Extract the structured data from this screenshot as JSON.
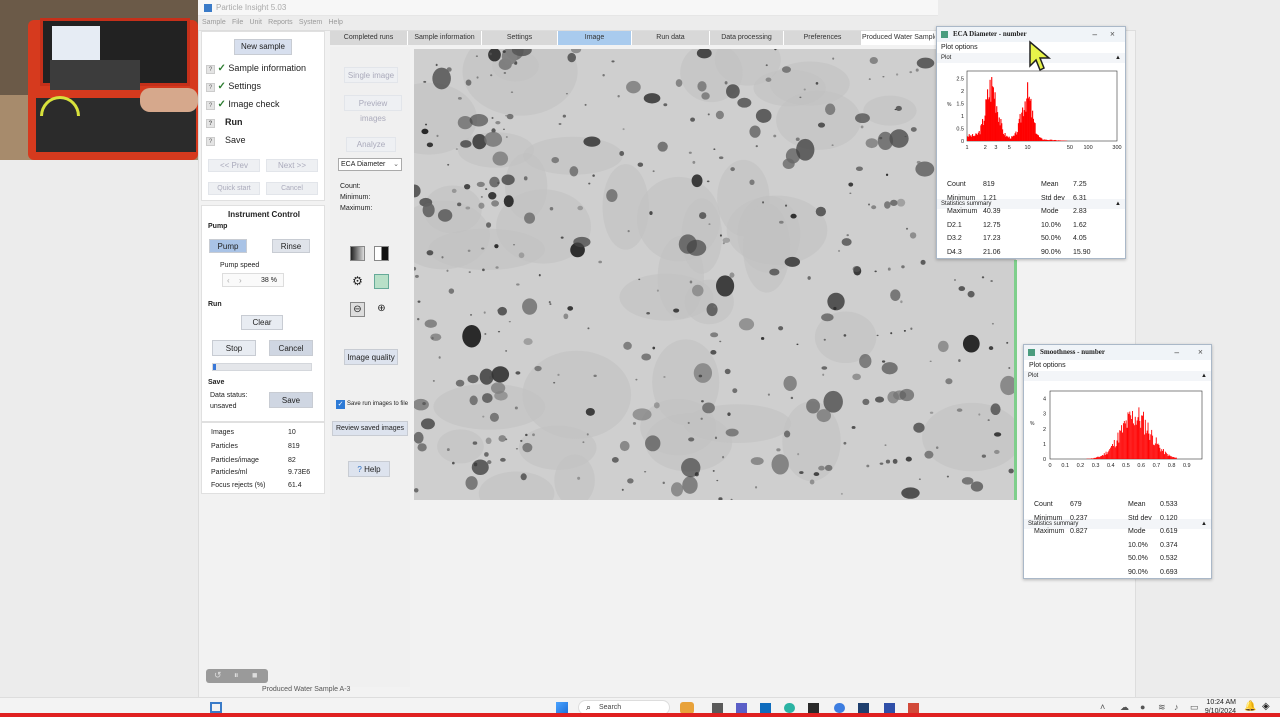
{
  "app": {
    "title": "Particle Insight   5.03",
    "menu": [
      "Sample",
      "File",
      "Unit",
      "Reports",
      "System",
      "Help"
    ]
  },
  "workflow": {
    "new_sample": "New sample",
    "steps": [
      {
        "label": "Sample information",
        "state": "done"
      },
      {
        "label": "Settings",
        "state": "done"
      },
      {
        "label": "Image check",
        "state": "done"
      },
      {
        "label": "Run",
        "state": "current"
      },
      {
        "label": "Save",
        "state": "pending"
      }
    ],
    "prev": "<< Prev",
    "next": "Next >>",
    "quick_start": "Quick start",
    "cancel": "Cancel"
  },
  "instrument": {
    "title": "Instrument Control",
    "pump_header": "Pump",
    "pump_btn": "Pump",
    "rinse_btn": "Rinse",
    "pump_speed_label": "Pump speed",
    "pump_speed_value": "38 %",
    "run_header": "Run",
    "clear_btn": "Clear",
    "stop_btn": "Stop",
    "cancel_btn": "Cancel",
    "progress": 0.03,
    "save_header": "Save",
    "data_status_label": "Data status:",
    "data_status_value": "unsaved",
    "save_btn": "Save"
  },
  "summary": {
    "rows": [
      {
        "label": "Images",
        "value": "10"
      },
      {
        "label": "Particles",
        "value": "819"
      },
      {
        "label": "Particles/image",
        "value": "82"
      },
      {
        "label": "Particles/ml",
        "value": "9.73E6"
      },
      {
        "label": "Focus rejects (%)",
        "value": "61.4"
      }
    ]
  },
  "tabs": [
    {
      "label": "Completed runs",
      "active": false
    },
    {
      "label": "Sample information",
      "active": false
    },
    {
      "label": "Settings",
      "active": false
    },
    {
      "label": "Image",
      "active": true
    },
    {
      "label": "Run data",
      "active": false
    },
    {
      "label": "Data processing",
      "active": false
    },
    {
      "label": "Preferences",
      "active": false
    },
    {
      "label": "Produced Water Sample A-3",
      "active": false
    }
  ],
  "tools": {
    "single_image": "Single image",
    "preview_images": "Preview images",
    "analyze": "Analyze",
    "measure_select": "ECA Diameter",
    "count_label": "Count:",
    "min_label": "Minimum:",
    "max_label": "Maximum:",
    "image_quality": "Image quality",
    "save_run_images": "Save run images to file",
    "review_saved": "Review saved images",
    "help": "Help"
  },
  "eca_window": {
    "title": "ECA Diameter - number",
    "plot_options": "Plot options",
    "plot_header": "Plot",
    "stats_header": "Statistics summary",
    "stats": [
      {
        "label": "Count",
        "value": "819",
        "label2": "Mean",
        "value2": "7.25"
      },
      {
        "label": "Minimum",
        "value": "1.21",
        "label2": "Std dev",
        "value2": "6.31"
      },
      {
        "label": "Maximum",
        "value": "40.39",
        "label2": "Mode",
        "value2": "2.83"
      },
      {
        "label": "D2.1",
        "value": "12.75",
        "label2": "10.0%",
        "value2": "1.62"
      },
      {
        "label": "D3.2",
        "value": "17.23",
        "label2": "50.0%",
        "value2": "4.05"
      },
      {
        "label": "D4.3",
        "value": "21.06",
        "label2": "90.0%",
        "value2": "15.90"
      }
    ]
  },
  "smooth_window": {
    "title": "Smoothness - number",
    "plot_options": "Plot options",
    "plot_header": "Plot",
    "stats_header": "Statistics summary",
    "stats": [
      {
        "label": "Count",
        "value": "679",
        "label2": "Mean",
        "value2": "0.533"
      },
      {
        "label": "Minimum",
        "value": "0.237",
        "label2": "Std dev",
        "value2": "0.120"
      },
      {
        "label": "Maximum",
        "value": "0.827",
        "label2": "Mode",
        "value2": "0.619"
      },
      {
        "label": "",
        "value": "",
        "label2": "10.0%",
        "value2": "0.374"
      },
      {
        "label": "",
        "value": "",
        "label2": "50.0%",
        "value2": "0.532"
      },
      {
        "label": "",
        "value": "",
        "label2": "90.0%",
        "value2": "0.693"
      }
    ]
  },
  "chart_data": [
    {
      "type": "bar",
      "title": "",
      "xlabel": "",
      "ylabel": "%",
      "x_scale": "log",
      "x_ticks": [
        "1",
        "2",
        "3",
        "5",
        "10",
        "50",
        "100",
        "300"
      ],
      "y_ticks": [
        "0",
        "0.5",
        "1",
        "1.5",
        "2",
        "2.5"
      ],
      "ylim": [
        0,
        2.8
      ],
      "color": "#ff0000"
    },
    {
      "type": "bar",
      "title": "",
      "xlabel": "",
      "ylabel": "%",
      "x_ticks": [
        "0",
        "0.1",
        "0.2",
        "0.3",
        "0.4",
        "0.5",
        "0.6",
        "0.7",
        "0.8",
        "0.9"
      ],
      "y_ticks": [
        "0",
        "1",
        "2",
        "3",
        "4"
      ],
      "ylim": [
        0,
        4.5
      ],
      "color": "#ff0000"
    }
  ],
  "status_bar": {
    "sample": "Produced Water Sample A-3"
  },
  "taskbar": {
    "search": "Search",
    "time": "10:24 AM",
    "date": "9/10/2024"
  }
}
